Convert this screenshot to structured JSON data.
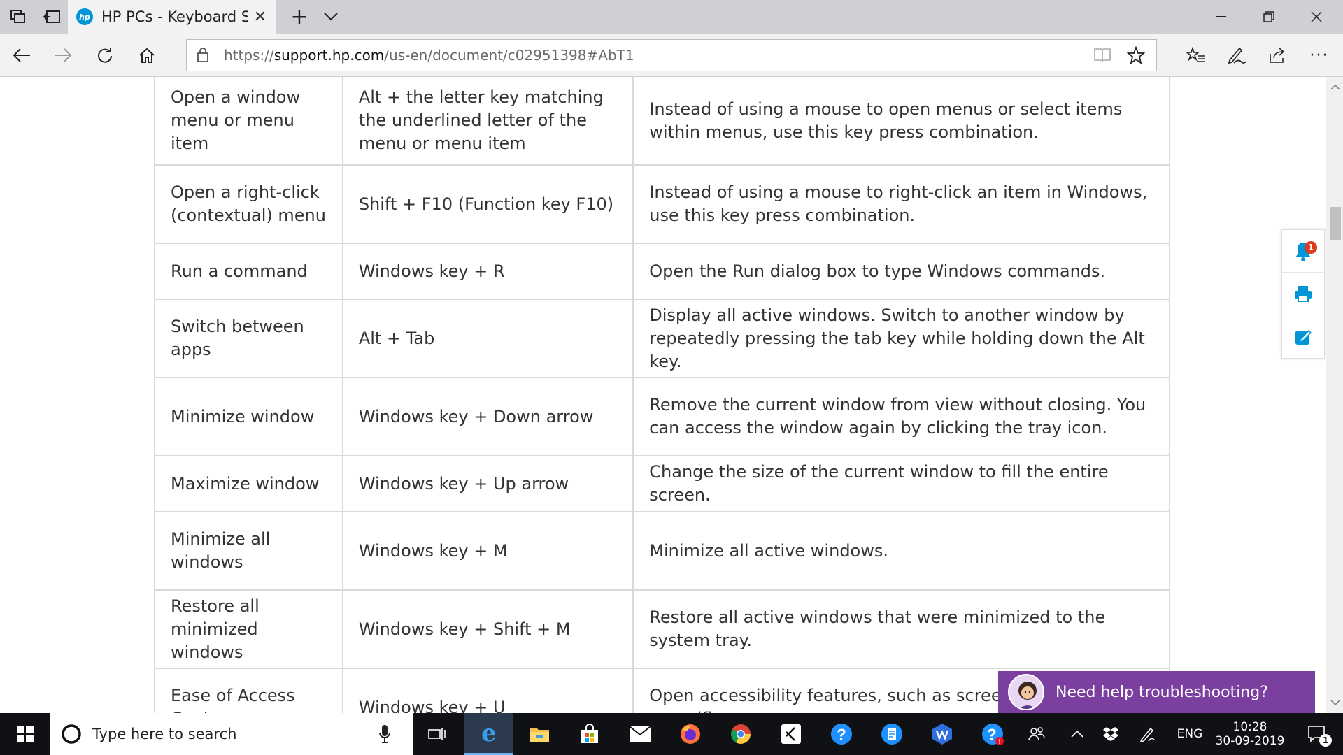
{
  "browser": {
    "tab_title": "HP PCs - Keyboard Shor",
    "tab_favicon_text": "hp",
    "url_prefix": "https://",
    "url_host": "support.hp.com",
    "url_path": "/us-en/document/c02951398#AbT1"
  },
  "table": {
    "rows": [
      {
        "action": "Open a window menu or menu item",
        "keys": "Alt + the letter key matching the underlined letter of the menu or menu item",
        "description": "Instead of using a mouse to open menus or select items within menus, use this key press combination."
      },
      {
        "action": "Open a right-click (contextual) menu",
        "keys": "Shift + F10 (Function key F10)",
        "description": "Instead of using a mouse to right-click an item in Windows, use this key press combination."
      },
      {
        "action": "Run a command",
        "keys": "Windows key + R",
        "description": "Open the Run dialog box to type Windows commands."
      },
      {
        "action": "Switch between apps",
        "keys": "Alt + Tab",
        "description": "Display all active windows. Switch to another window by repeatedly pressing the tab key while holding down the Alt key."
      },
      {
        "action": "Minimize window",
        "keys": "Windows key + Down arrow",
        "description": "Remove the current window from view without closing. You can access the window again by clicking the tray icon."
      },
      {
        "action": "Maximize window",
        "keys": "Windows key + Up arrow",
        "description": "Change the size of the current window to fill the entire screen."
      },
      {
        "action": "Minimize all windows",
        "keys": "Windows key + M",
        "description": "Minimize all active windows."
      },
      {
        "action": "Restore all minimized windows",
        "keys": "Windows key + Shift + M",
        "description": "Restore all active windows that were minimized to the system tray."
      },
      {
        "action": "Ease of Access Center",
        "keys": "Windows key + U",
        "description": "Open accessibility features, such as screen reader and magnifier."
      }
    ]
  },
  "float_tools": {
    "notification_count": "1"
  },
  "chat": {
    "label": "Need help troubleshooting?"
  },
  "taskbar": {
    "search_placeholder": "Type here to search",
    "language": "ENG",
    "time": "10:28",
    "date": "30-09-2019",
    "notification_count": "1"
  }
}
